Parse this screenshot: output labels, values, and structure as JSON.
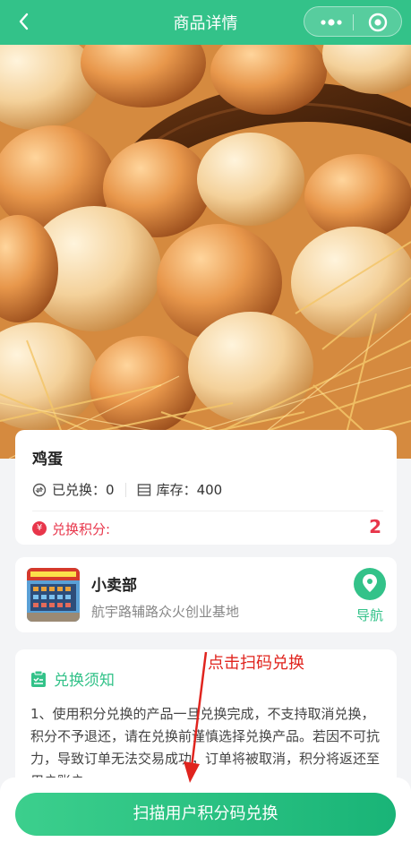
{
  "header": {
    "title": "商品详情"
  },
  "product": {
    "name": "鸡蛋",
    "redeemed_label": "已兑换：",
    "redeemed_count": "0",
    "stock_label": "库存：",
    "stock_count": "400",
    "points_label": "兑换积分:",
    "points_value": "2"
  },
  "store": {
    "name": "小卖部",
    "address": "航宇路辅路众火创业基地",
    "nav_label": "导航"
  },
  "notice": {
    "title": "兑换须知",
    "body": "1、使用积分兑换的产品一旦兑换完成，不支持取消兑换，积分不予退还，请在兑换前谨慎选择兑换产品。若因不可抗力，导致订单无法交易成功，订单将被取消，积分将返还至用户账户。"
  },
  "annotation": {
    "text": "点击扫码兑换"
  },
  "bottom": {
    "scan_button_label": "扫描用户积分码兑换"
  },
  "colors": {
    "brand": "#33c289",
    "accent_red": "#e8364b"
  }
}
